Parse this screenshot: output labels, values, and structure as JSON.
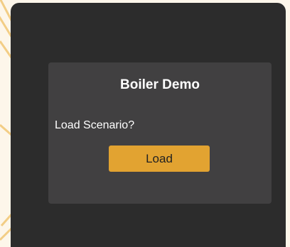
{
  "dialog": {
    "title": "Boiler Demo",
    "message": "Load Scenario?",
    "load_label": "Load"
  },
  "colors": {
    "backdrop": "#fdf6ea",
    "backdrop_stripe": "#f2cd85",
    "outer_panel": "#2c2c2c",
    "dialog": "#414041",
    "accent": "#e2a331",
    "text": "#ffffff"
  }
}
